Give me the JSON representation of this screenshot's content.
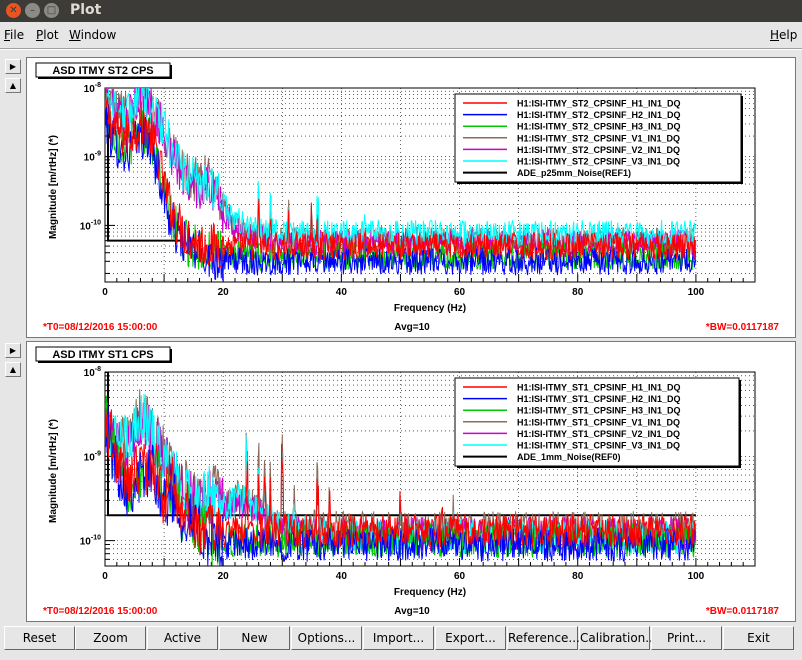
{
  "window": {
    "title": "Plot"
  },
  "menu": {
    "file": "File",
    "plot": "Plot",
    "window": "Window",
    "help": "Help"
  },
  "colors": {
    "red": "#ff0000",
    "blue": "#0000ff",
    "green": "#00c800",
    "brown": "#8b6b5b",
    "magenta": "#cc00cc",
    "cyan": "#00ffff",
    "black": "#000000"
  },
  "footer_buttons": [
    "Reset",
    "Zoom",
    "Active",
    "New",
    "Options...",
    "Import...",
    "Export...",
    "Reference...",
    "Calibration...",
    "Print...",
    "Exit"
  ],
  "chart_data": [
    {
      "type": "line",
      "title": "ASD ITMY ST2 CPS",
      "xlabel": "Frequency (Hz)",
      "ylabel": "Magnitude [m/rtHz] (*)",
      "x_ticks": [
        "0",
        "20",
        "40",
        "60",
        "80",
        "100"
      ],
      "xlim": [
        0,
        110
      ],
      "y_scale": "log",
      "ylim": [
        1.5e-11,
        1e-08
      ],
      "y_ticks": [
        "10^-10",
        "10^-9",
        "10^-8"
      ],
      "grid": true,
      "legend_position": "top-right",
      "footer": {
        "left": "*T0=08/12/2016 15:00:00",
        "center": "Avg=10",
        "right": "*BW=0.0117187"
      },
      "series": [
        {
          "name": "H1:ISI-ITMY_ST2_CPSINF_H1_IN1_DQ",
          "color": "red",
          "x": [
            0,
            1,
            2,
            3,
            4,
            5,
            6,
            7,
            8,
            9,
            10,
            11,
            12,
            13,
            14,
            15,
            16,
            18,
            20,
            25,
            30,
            40,
            50,
            60,
            70,
            80,
            90,
            100
          ],
          "y": [
            6e-09,
            3e-09,
            2.5e-09,
            2e-09,
            2e-09,
            2.5e-09,
            3e-09,
            2.8e-09,
            2e-09,
            1e-09,
            4e-10,
            2e-10,
            1.2e-10,
            9e-11,
            7e-11,
            6e-11,
            5.5e-11,
            5e-11,
            5e-11,
            5e-11,
            5e-11,
            5e-11,
            5e-11,
            5e-11,
            5e-11,
            5e-11,
            5e-11,
            5e-11
          ]
        },
        {
          "name": "H1:ISI-ITMY_ST2_CPSINF_H2_IN1_DQ",
          "color": "blue",
          "x": [
            0,
            1,
            2,
            3,
            4,
            5,
            6,
            7,
            8,
            9,
            10,
            11,
            12,
            13,
            14,
            15,
            16,
            18,
            20,
            25,
            30,
            40,
            50,
            60,
            70,
            80,
            90,
            100
          ],
          "y": [
            4e-09,
            2e-09,
            1.5e-09,
            1.2e-09,
            1.2e-09,
            1.5e-09,
            2e-09,
            2e-09,
            1.3e-09,
            6e-10,
            2.5e-10,
            1.2e-10,
            8e-11,
            6e-11,
            5e-11,
            4.5e-11,
            4e-11,
            3.5e-11,
            3.2e-11,
            3e-11,
            3e-11,
            3e-11,
            3e-11,
            3e-11,
            3e-11,
            3e-11,
            3e-11,
            3e-11
          ]
        },
        {
          "name": "H1:ISI-ITMY_ST2_CPSINF_H3_IN1_DQ",
          "color": "green",
          "x": [
            0,
            1,
            2,
            3,
            4,
            5,
            6,
            7,
            8,
            9,
            10,
            11,
            12,
            13,
            14,
            15,
            16,
            18,
            20,
            25,
            30,
            40,
            50,
            60,
            70,
            80,
            90,
            100
          ],
          "y": [
            5e-09,
            2.5e-09,
            2e-09,
            1.5e-09,
            1.5e-09,
            2e-09,
            2.5e-09,
            2.3e-09,
            1.5e-09,
            7e-10,
            3e-10,
            1.4e-10,
            9e-11,
            6.5e-11,
            5.5e-11,
            5e-11,
            4.5e-11,
            4e-11,
            3.8e-11,
            3.6e-11,
            3.6e-11,
            3.6e-11,
            3.6e-11,
            3.6e-11,
            3.6e-11,
            3.6e-11,
            3.6e-11,
            3.6e-11
          ]
        },
        {
          "name": "H1:ISI-ITMY_ST2_CPSINF_V1_IN1_DQ",
          "color": "brown",
          "x": [
            0,
            2,
            4,
            5,
            6,
            7,
            8,
            9,
            10,
            11,
            12,
            13,
            14,
            15,
            16,
            17,
            18,
            19,
            20,
            22,
            25,
            30,
            40,
            50,
            60,
            70,
            80,
            90,
            100
          ],
          "y": [
            9e-09,
            5e-09,
            4e-09,
            6e-09,
            1e-08,
            8e-09,
            6e-09,
            4e-09,
            2.5e-09,
            1.5e-09,
            1e-09,
            7e-10,
            5e-10,
            5e-10,
            4e-10,
            5e-10,
            4e-10,
            3e-10,
            2e-10,
            1e-10,
            7e-11,
            6e-11,
            6e-11,
            6e-11,
            6e-11,
            6e-11,
            6e-11,
            6e-11,
            6e-11
          ]
        },
        {
          "name": "H1:ISI-ITMY_ST2_CPSINF_V2_IN1_DQ",
          "color": "magenta",
          "x": [
            0,
            2,
            4,
            5,
            6,
            7,
            8,
            9,
            10,
            11,
            12,
            13,
            14,
            15,
            16,
            17,
            18,
            19,
            20,
            22,
            25,
            30,
            40,
            50,
            60,
            70,
            80,
            90,
            100
          ],
          "y": [
            8e-09,
            4e-09,
            3.5e-09,
            5e-09,
            9e-09,
            7e-09,
            5e-09,
            3.5e-09,
            2e-09,
            1.2e-09,
            8e-10,
            6e-10,
            4e-10,
            4e-10,
            3.5e-10,
            4e-10,
            3e-10,
            2.5e-10,
            1.5e-10,
            9e-11,
            6.5e-11,
            5.5e-11,
            5.5e-11,
            5.5e-11,
            5.5e-11,
            5.5e-11,
            5.5e-11,
            5.5e-11,
            5.5e-11
          ]
        },
        {
          "name": "H1:ISI-ITMY_ST2_CPSINF_V3_IN1_DQ",
          "color": "cyan",
          "x": [
            0,
            2,
            4,
            5,
            6,
            7,
            8,
            9,
            10,
            11,
            12,
            13,
            14,
            15,
            16,
            17,
            18,
            19,
            20,
            22,
            25,
            30,
            40,
            50,
            60,
            70,
            80,
            90,
            100
          ],
          "y": [
            9e-09,
            5e-09,
            4e-09,
            6e-09,
            1e-08,
            7e-09,
            5e-09,
            4e-09,
            2.5e-09,
            1.5e-09,
            1e-09,
            7e-10,
            5e-10,
            4.5e-10,
            4e-10,
            4.5e-10,
            3.5e-10,
            3e-10,
            2e-10,
            1.2e-10,
            9e-11,
            7.5e-11,
            7.5e-11,
            7.5e-11,
            7.5e-11,
            7.5e-11,
            7.5e-11,
            7.5e-11,
            7.5e-11
          ]
        },
        {
          "name": "ADE_p25mm_Noise(REF1)",
          "color": "black",
          "x": [
            0,
            0.5,
            0.5,
            13
          ],
          "y": [
            1e-08,
            1e-08,
            6e-11,
            6e-11
          ]
        }
      ]
    },
    {
      "type": "line",
      "title": "ASD ITMY ST1 CPS",
      "xlabel": "Frequency (Hz)",
      "ylabel": "Magnitude [m/rtHz] (*)",
      "x_ticks": [
        "0",
        "20",
        "40",
        "60",
        "80",
        "100"
      ],
      "xlim": [
        0,
        110
      ],
      "y_scale": "log",
      "ylim": [
        5e-11,
        1e-08
      ],
      "y_ticks": [
        "10^-10",
        "10^-9",
        "10^-8"
      ],
      "grid": true,
      "legend_position": "top-right",
      "footer": {
        "left": "*T0=08/12/2016 15:00:00",
        "center": "Avg=10",
        "right": "*BW=0.0117187"
      },
      "series": [
        {
          "name": "H1:ISI-ITMY_ST1_CPSINF_H1_IN1_DQ",
          "color": "red",
          "x": [
            0,
            1,
            2,
            3,
            4,
            5,
            6,
            7,
            8,
            9,
            10,
            11,
            12,
            13,
            14,
            15,
            16,
            17,
            18,
            20,
            25,
            30,
            40,
            50,
            60,
            70,
            80,
            90,
            100
          ],
          "y": [
            3e-09,
            1.5e-09,
            1e-09,
            6e-10,
            5e-10,
            6e-10,
            8e-10,
            7e-10,
            8e-10,
            6e-10,
            3e-10,
            5e-10,
            4e-10,
            2e-10,
            2.5e-10,
            1.8e-10,
            1.5e-10,
            1.4e-10,
            1.3e-10,
            1.3e-10,
            1.3e-10,
            1.3e-10,
            1.3e-10,
            1.3e-10,
            1.3e-10,
            1.3e-10,
            1.3e-10,
            1.3e-10,
            1.3e-10
          ]
        },
        {
          "name": "H1:ISI-ITMY_ST1_CPSINF_H2_IN1_DQ",
          "color": "blue",
          "x": [
            0,
            1,
            2,
            3,
            4,
            5,
            6,
            7,
            8,
            9,
            10,
            11,
            12,
            13,
            14,
            15,
            16,
            17,
            18,
            20,
            25,
            30,
            40,
            50,
            60,
            70,
            80,
            90,
            100
          ],
          "y": [
            3e-09,
            1.2e-09,
            8e-10,
            5e-10,
            4e-10,
            5e-10,
            6e-10,
            6e-10,
            7e-10,
            5e-10,
            2.5e-10,
            4e-10,
            3e-10,
            1.8e-10,
            2e-10,
            1.5e-10,
            1.2e-10,
            1.1e-10,
            1e-10,
            9e-11,
            9e-11,
            9e-11,
            9e-11,
            9e-11,
            9e-11,
            9e-11,
            9e-11,
            9e-11,
            9e-11
          ]
        },
        {
          "name": "H1:ISI-ITMY_ST1_CPSINF_H3_IN1_DQ",
          "color": "green",
          "x": [
            0,
            1,
            2,
            3,
            4,
            5,
            6,
            7,
            8,
            9,
            10,
            11,
            12,
            13,
            14,
            15,
            16,
            17,
            18,
            20,
            25,
            30,
            40,
            50,
            60,
            70,
            80,
            90,
            100
          ],
          "y": [
            3.5e-09,
            1.3e-09,
            9e-10,
            5.5e-10,
            4.5e-10,
            5.5e-10,
            7e-10,
            6.5e-10,
            7.5e-10,
            5.5e-10,
            2.8e-10,
            4.5e-10,
            3.5e-10,
            1.9e-10,
            2.2e-10,
            1.6e-10,
            1.3e-10,
            1.2e-10,
            1.1e-10,
            1e-10,
            1e-10,
            1e-10,
            1e-10,
            1e-10,
            1e-10,
            1e-10,
            1e-10,
            1e-10,
            1e-10
          ]
        },
        {
          "name": "H1:ISI-ITMY_ST1_CPSINF_V1_IN1_DQ",
          "color": "brown",
          "x": [
            0,
            2,
            4,
            5,
            6,
            7,
            8,
            9,
            10,
            11,
            12,
            13,
            14,
            15,
            16,
            17,
            18,
            19,
            20,
            21,
            22,
            24,
            26,
            30,
            40,
            50,
            60,
            70,
            80,
            90,
            100
          ],
          "y": [
            3e-09,
            1.5e-09,
            1.5e-09,
            2e-09,
            3e-09,
            2.5e-09,
            2e-09,
            1.5e-09,
            1e-09,
            8e-10,
            6e-10,
            5e-10,
            4e-10,
            3.5e-10,
            3e-10,
            3.5e-10,
            4e-10,
            3.5e-10,
            3e-10,
            3e-10,
            3.5e-10,
            3e-10,
            2.5e-10,
            1.5e-10,
            1.4e-10,
            1.4e-10,
            1.4e-10,
            1.4e-10,
            1.4e-10,
            1.4e-10,
            1.4e-10
          ]
        },
        {
          "name": "H1:ISI-ITMY_ST1_CPSINF_V2_IN1_DQ",
          "color": "magenta",
          "x": [
            0,
            2,
            4,
            5,
            6,
            7,
            8,
            9,
            10,
            11,
            12,
            13,
            14,
            15,
            16,
            17,
            18,
            19,
            20,
            21,
            22,
            24,
            26,
            30,
            40,
            50,
            60,
            70,
            80,
            90,
            100
          ],
          "y": [
            2.5e-09,
            1.2e-09,
            1.2e-09,
            1.8e-09,
            2.8e-09,
            2.2e-09,
            1.8e-09,
            1.3e-09,
            9e-10,
            7e-10,
            5e-10,
            4.5e-10,
            3.5e-10,
            3e-10,
            2.8e-10,
            3e-10,
            3.5e-10,
            3e-10,
            2.5e-10,
            2.5e-10,
            3e-10,
            2.5e-10,
            2e-10,
            1.3e-10,
            1.2e-10,
            1.2e-10,
            1.2e-10,
            1.2e-10,
            1.2e-10,
            1.2e-10,
            1.2e-10
          ]
        },
        {
          "name": "H1:ISI-ITMY_ST1_CPSINF_V3_IN1_DQ",
          "color": "cyan",
          "x": [
            0,
            2,
            4,
            5,
            6,
            7,
            8,
            9,
            10,
            11,
            12,
            13,
            14,
            15,
            16,
            17,
            18,
            19,
            20,
            21,
            22,
            24,
            26,
            30,
            40,
            50,
            60,
            70,
            80,
            90,
            100
          ],
          "y": [
            3e-09,
            1.4e-09,
            1.4e-09,
            2e-09,
            3e-09,
            2.4e-09,
            2e-09,
            1.4e-09,
            1e-09,
            7.5e-10,
            5.5e-10,
            5e-10,
            4e-10,
            3.2e-10,
            3e-10,
            3.2e-10,
            3.8e-10,
            3.2e-10,
            2.8e-10,
            2.8e-10,
            3.2e-10,
            2.8e-10,
            2.2e-10,
            1.4e-10,
            1.1e-10,
            1.1e-10,
            1.1e-10,
            1.1e-10,
            1.1e-10,
            1.1e-10,
            1.1e-10
          ]
        },
        {
          "name": "ADE_1mm_Noise(REF0)",
          "color": "black",
          "x": [
            0,
            0.5,
            0.5,
            100
          ],
          "y": [
            1e-08,
            1e-08,
            2e-10,
            2e-10
          ]
        }
      ]
    }
  ]
}
